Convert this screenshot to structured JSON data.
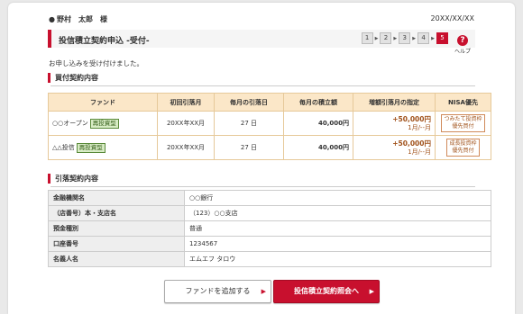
{
  "header": {
    "user_name": "野村　太郎　様",
    "date": "20XX/XX/XX",
    "user_icon": "person-icon"
  },
  "title": "投信積立契約申込 -受付-",
  "steps": [
    "1",
    "2",
    "3",
    "4",
    "5"
  ],
  "active_step": 5,
  "help_label": "ヘルプ",
  "message": "お申し込みを受け付けました。",
  "purchase_section": {
    "heading": "買付契約内容",
    "columns": [
      "ファンド",
      "初回引落月",
      "毎月の引落日",
      "毎月の積立額",
      "増額引落月の指定",
      "NISA優先"
    ],
    "rows": [
      {
        "fund": "○○オープン",
        "badge": "再投資型",
        "first_month": "20XX年XX月",
        "monthly_day": "27 日",
        "monthly_amount": "40,000円",
        "increase_amount": "+50,000円",
        "increase_months": "1月/--月",
        "nisa_line1": "つみたて投資枠",
        "nisa_line2": "優先買付"
      },
      {
        "fund": "△△投信",
        "badge": "再投資型",
        "first_month": "20XX年XX月",
        "monthly_day": "27 日",
        "monthly_amount": "40,000円",
        "increase_amount": "+50,000円",
        "increase_months": "1月/--月",
        "nisa_line1": "成長投資枠",
        "nisa_line2": "優先買付"
      }
    ]
  },
  "withdrawal_section": {
    "heading": "引落契約内容",
    "rows": [
      {
        "label": "金融機関名",
        "value": "○○銀行"
      },
      {
        "label": "（店番号）本・支店名",
        "value": "（123）○○支店"
      },
      {
        "label": "預金種別",
        "value": "普通"
      },
      {
        "label": "口座番号",
        "value": "1234567"
      },
      {
        "label": "名義人名",
        "value": "エムエフ タロウ"
      }
    ]
  },
  "buttons": {
    "add_fund": "ファンドを追加する",
    "to_inquiry": "投信積立契約照会へ"
  },
  "colors": {
    "accent": "#c8102e",
    "table_header": "#fbe7c8",
    "badge_green": "#d8ecc5"
  }
}
